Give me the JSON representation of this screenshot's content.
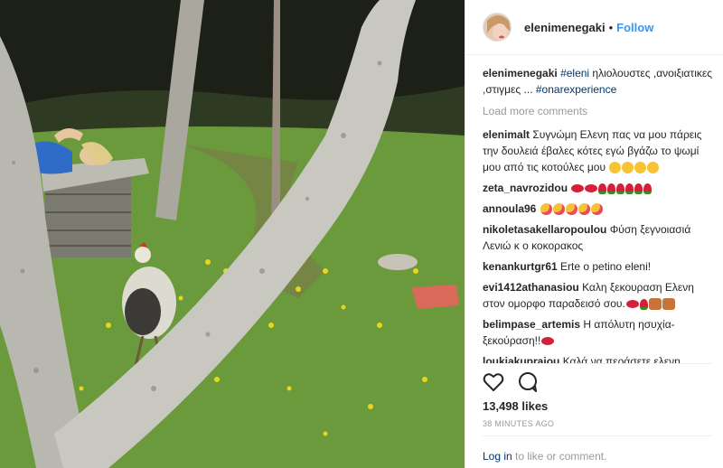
{
  "header": {
    "username": "elenimenegaki",
    "separator": "•",
    "follow": "Follow"
  },
  "caption": {
    "username": "elenimenegaki",
    "tag1": "#eleni",
    "text": " ηλιολουστες ,ανοιξιατικες ,στιγμες ... ",
    "tag2": "#onarexperience"
  },
  "load_more": "Load more comments",
  "comments": [
    {
      "username": "elenimalt",
      "text": " Συγνώμη Ελενη πας να μου πάρεις την δουλειά έβαλες κότες εγώ βγάζω το ψωμί μου από τις κοτούλες μου",
      "emoji": [
        "emo-face",
        "emo-face",
        "emo-face",
        "emo-face"
      ]
    },
    {
      "username": "zeta_navrozidou",
      "text": " ",
      "emoji": [
        "emo-lips",
        "emo-lips",
        "emo-rose",
        "emo-rose",
        "emo-rose",
        "emo-rose",
        "emo-rose",
        "emo-rose"
      ]
    },
    {
      "username": "annoula96",
      "text": " ",
      "emoji": [
        "emo-kiss",
        "emo-kiss",
        "emo-kiss",
        "emo-kiss",
        "emo-kiss"
      ]
    },
    {
      "username": "nikoletasakellaropoulou",
      "text": " Φύση ξεγνοιασιά Λενιώ κ ο κοκορακος",
      "emoji": []
    },
    {
      "username": "kenankurtgr61",
      "text": " Erte o petino eleni!",
      "emoji": []
    },
    {
      "username": "evi1412athanasiou",
      "text": " Καλη ξεκουραση Ελενη στον ομορφο παραδεισό σου.",
      "emoji": [
        "emo-lips",
        "emo-rose",
        "emo-people",
        "emo-people"
      ]
    },
    {
      "username": "belimpase_artemis",
      "text": " Η απόλυτη ησυχία-ξεκούραση!!",
      "emoji": [
        "emo-lips"
      ]
    },
    {
      "username": "loukiakupraiou",
      "text": " Καλά να περάσετε ελενη",
      "emoji": []
    }
  ],
  "actions": {
    "like_icon": "heart-icon",
    "comment_icon": "comment-icon"
  },
  "likes": "13,498 likes",
  "time": "38 MINUTES AGO",
  "login": {
    "link": "Log in",
    "text": " to like or comment."
  }
}
